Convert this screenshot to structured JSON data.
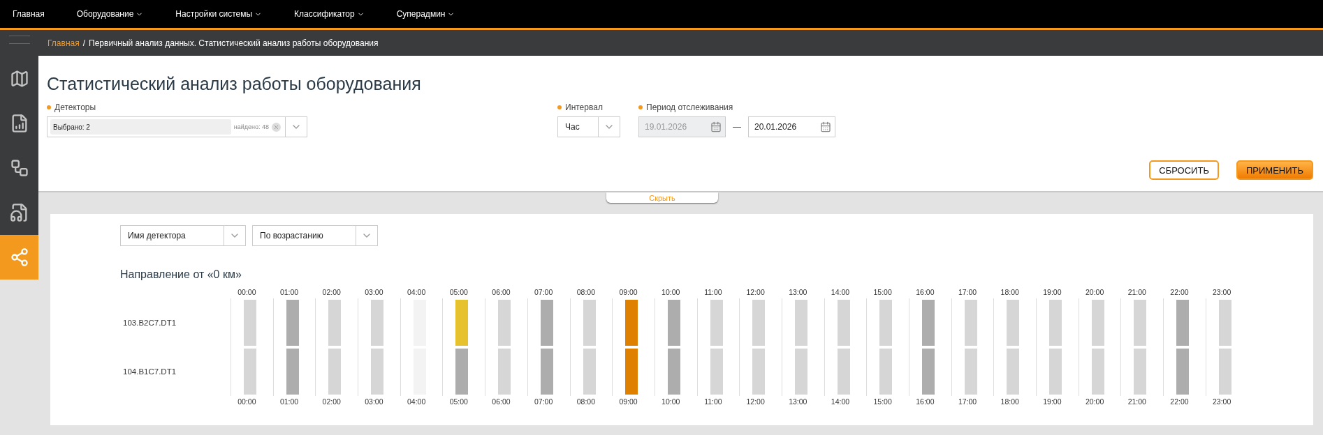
{
  "top_nav": [
    {
      "label": "Главная",
      "dropdown": false
    },
    {
      "label": "Оборудование",
      "dropdown": true
    },
    {
      "label": "Настройки системы",
      "dropdown": true
    },
    {
      "label": "Классификатор",
      "dropdown": true
    },
    {
      "label": "Суперадмин",
      "dropdown": true
    }
  ],
  "sidebar": {
    "items": [
      {
        "kind": "map",
        "selected": false
      },
      {
        "kind": "report",
        "selected": false
      },
      {
        "kind": "graph",
        "selected": false
      },
      {
        "kind": "disc",
        "selected": false
      },
      {
        "kind": "network",
        "selected": true
      }
    ]
  },
  "breadcrumb": {
    "link": "Главная",
    "separator": "/",
    "current": "Первичный анализ данных. Статистический анализ работы оборудования"
  },
  "title": "Статистический анализ работы оборудования",
  "filters": {
    "detectors": {
      "label": "Детекторы",
      "value": "Выбрано: 2",
      "found": "найдено: 48"
    },
    "interval": {
      "label": "Интервал",
      "value": "Час"
    },
    "period": {
      "label": "Период отслеживания",
      "from": "19.01.2026",
      "from_disabled": true,
      "dash": "—",
      "to": "20.01.2026"
    }
  },
  "buttons": {
    "reset": "СБРОСИТЬ",
    "apply": "ПРИМЕНИТЬ"
  },
  "hide_tab": "Скрыть",
  "sort": {
    "field": "Имя детектора",
    "order": "По возрастанию"
  },
  "section_title": "Направление от «0 км»",
  "hours_bottom": [
    "00:00",
    "01:00",
    "02:00",
    "03:00",
    "04:00",
    "05:00",
    "06:00",
    "07:00",
    "08:00",
    "09:00",
    "10:00",
    "11:00",
    "12:00",
    "13:00",
    "14:00",
    "15:00",
    "16:00",
    "17:00",
    "18:00",
    "19:00",
    "20:00",
    "21:00",
    "22:00",
    "23:00"
  ],
  "hours_top": [
    "00:00",
    "01:00",
    "02:00",
    "03:00",
    "04:00",
    "05:00",
    "06:00",
    "07:00",
    "08:00",
    "09:00",
    "10:00",
    "11:00",
    "12:00",
    "13:00",
    "14:00",
    "15:00",
    "16:00",
    "17:00",
    "18:00",
    "19:00",
    "20:00",
    "21:00",
    "22:00",
    "23:00"
  ],
  "rows": [
    {
      "name": "103.B2C7.DT1",
      "cells": [
        {
          "color": "#d6d6d6"
        },
        {
          "color": "#adadad"
        },
        {
          "color": "#d6d6d6"
        },
        {
          "color": "#d6d6d6"
        },
        {
          "color": "#f3f3f3"
        },
        {
          "color": "#e6c32e"
        },
        {
          "color": "#d6d6d6"
        },
        {
          "color": "#adadad"
        },
        {
          "color": "#d6d6d6"
        },
        {
          "color": "#e08000"
        },
        {
          "color": "#adadad"
        },
        {
          "color": "#d6d6d6"
        },
        {
          "color": "#d6d6d6"
        },
        {
          "color": "#d6d6d6"
        },
        {
          "color": "#d6d6d6"
        },
        {
          "color": "#d6d6d6"
        },
        {
          "color": "#adadad"
        },
        {
          "color": "#d6d6d6"
        },
        {
          "color": "#d6d6d6"
        },
        {
          "color": "#d6d6d6"
        },
        {
          "color": "#d6d6d6"
        },
        {
          "color": "#d6d6d6"
        },
        {
          "color": "#adadad"
        },
        {
          "color": "#d6d6d6"
        }
      ]
    },
    {
      "name": "104.B1C7.DT1",
      "cells": [
        {
          "color": "#d6d6d6"
        },
        {
          "color": "#adadad"
        },
        {
          "color": "#d6d6d6"
        },
        {
          "color": "#d6d6d6"
        },
        {
          "color": "#f3f3f3"
        },
        {
          "color": "#adadad"
        },
        {
          "color": "#d6d6d6"
        },
        {
          "color": "#adadad"
        },
        {
          "color": "#d6d6d6"
        },
        {
          "color": "#e08000"
        },
        {
          "color": "#adadad"
        },
        {
          "color": "#d6d6d6"
        },
        {
          "color": "#d6d6d6"
        },
        {
          "color": "#d6d6d6"
        },
        {
          "color": "#d6d6d6"
        },
        {
          "color": "#d6d6d6"
        },
        {
          "color": "#adadad"
        },
        {
          "color": "#d6d6d6"
        },
        {
          "color": "#d6d6d6"
        },
        {
          "color": "#d6d6d6"
        },
        {
          "color": "#d6d6d6"
        },
        {
          "color": "#d6d6d6"
        },
        {
          "color": "#adadad"
        },
        {
          "color": "#d6d6d6"
        }
      ]
    }
  ]
}
